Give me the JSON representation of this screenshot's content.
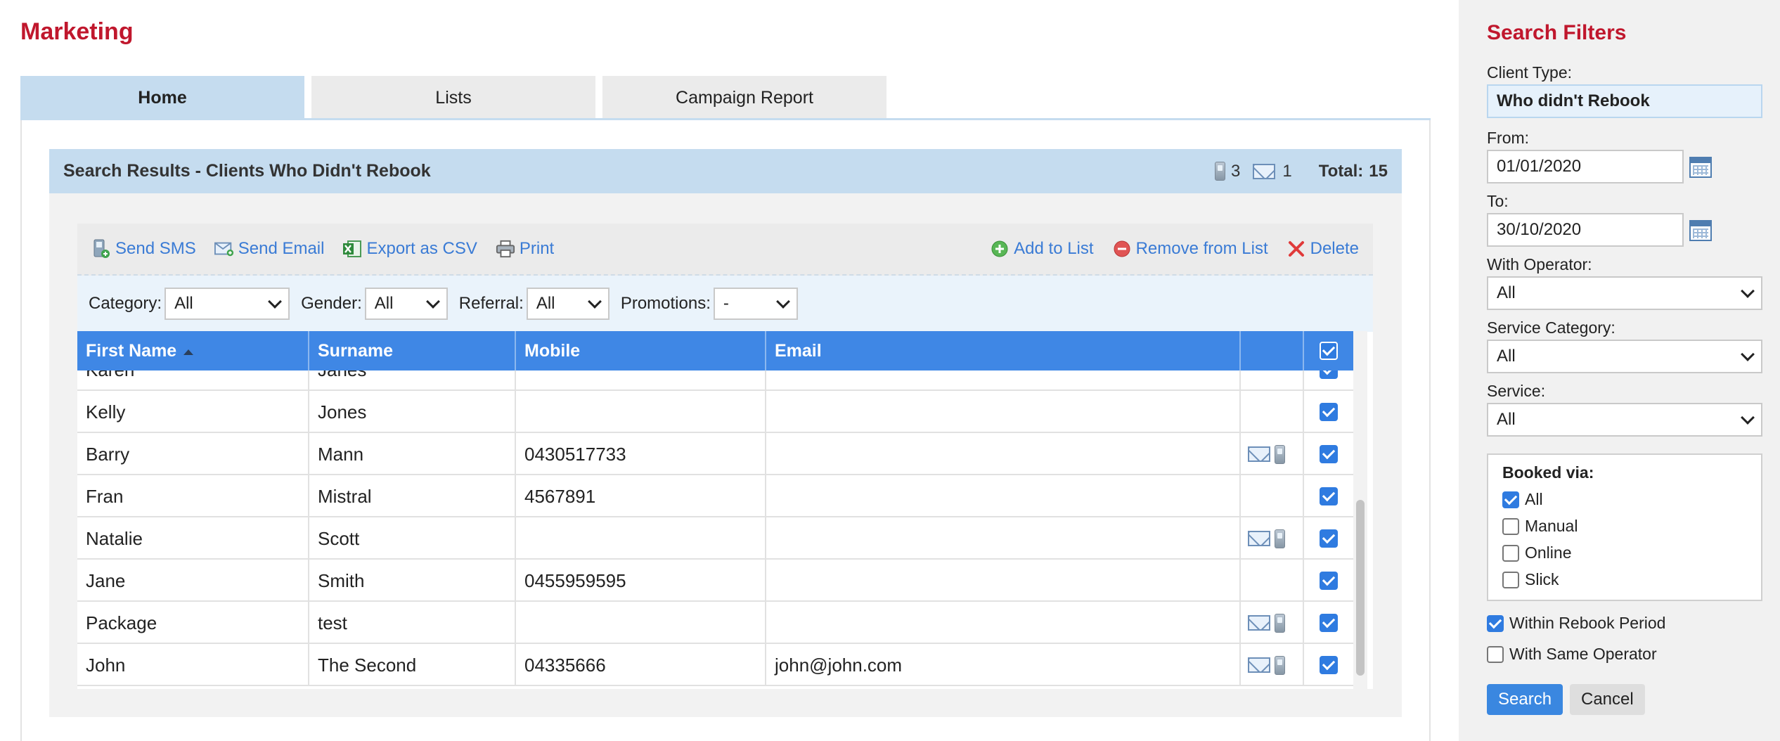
{
  "app": {
    "title": "Marketing"
  },
  "tabs": [
    {
      "label": "Home",
      "active": true
    },
    {
      "label": "Lists",
      "active": false
    },
    {
      "label": "Campaign Report",
      "active": false
    }
  ],
  "results": {
    "title": "Search Results - Clients Who Didn't Rebook",
    "sms_count": "3",
    "email_count": "1",
    "total_label": "Total:",
    "total_value": "15"
  },
  "toolbar": {
    "send_sms": "Send SMS",
    "send_email": "Send Email",
    "export_csv": "Export as CSV",
    "print": "Print",
    "add_to_list": "Add to List",
    "remove_from_list": "Remove from List",
    "delete": "Delete"
  },
  "filters": {
    "category": {
      "label": "Category:",
      "value": "All"
    },
    "gender": {
      "label": "Gender:",
      "value": "All"
    },
    "referral": {
      "label": "Referral:",
      "value": "All"
    },
    "promotions": {
      "label": "Promotions:",
      "value": "-"
    }
  },
  "table": {
    "columns": [
      "First Name",
      "Surname",
      "Mobile",
      "Email"
    ],
    "rows": [
      {
        "first": "Karen",
        "surname": "Janes",
        "mobile": "",
        "email": "",
        "has_contact_icons": false,
        "checked": true
      },
      {
        "first": "Kelly",
        "surname": "Jones",
        "mobile": "",
        "email": "",
        "has_contact_icons": false,
        "checked": true
      },
      {
        "first": "Barry",
        "surname": "Mann",
        "mobile": "0430517733",
        "email": "",
        "has_contact_icons": true,
        "checked": true
      },
      {
        "first": "Fran",
        "surname": "Mistral",
        "mobile": "4567891",
        "email": "",
        "has_contact_icons": false,
        "checked": true
      },
      {
        "first": "Natalie",
        "surname": "Scott",
        "mobile": "",
        "email": "",
        "has_contact_icons": true,
        "checked": true
      },
      {
        "first": "Jane",
        "surname": "Smith",
        "mobile": "0455959595",
        "email": "",
        "has_contact_icons": false,
        "checked": true
      },
      {
        "first": "Package",
        "surname": "test",
        "mobile": "",
        "email": "",
        "has_contact_icons": true,
        "checked": true
      },
      {
        "first": "John",
        "surname": "The Second",
        "mobile": "04335666",
        "email": "john@john.com",
        "has_contact_icons": true,
        "checked": true
      }
    ]
  },
  "sidebar": {
    "title": "Search Filters",
    "client_type": {
      "label": "Client Type:",
      "value": "Who didn't Rebook"
    },
    "from": {
      "label": "From:",
      "value": "01/01/2020"
    },
    "to": {
      "label": "To:",
      "value": "30/10/2020"
    },
    "with_operator": {
      "label": "With Operator:",
      "value": "All"
    },
    "service_category": {
      "label": "Service Category:",
      "value": "All"
    },
    "service": {
      "label": "Service:",
      "value": "All"
    },
    "booked_via": {
      "label": "Booked via:",
      "options": [
        {
          "label": "All",
          "checked": true
        },
        {
          "label": "Manual",
          "checked": false
        },
        {
          "label": "Online",
          "checked": false
        },
        {
          "label": "Slick",
          "checked": false
        }
      ]
    },
    "within_rebook_period": {
      "label": "Within Rebook Period",
      "checked": true
    },
    "with_same_operator": {
      "label": "With Same Operator",
      "checked": false
    },
    "search_button": "Search",
    "cancel_button": "Cancel"
  },
  "colors": {
    "brand_red": "#c0172d",
    "header_blue": "#3f87e5",
    "tab_active": "#c5dcef",
    "link_blue": "#3a7bd5"
  }
}
